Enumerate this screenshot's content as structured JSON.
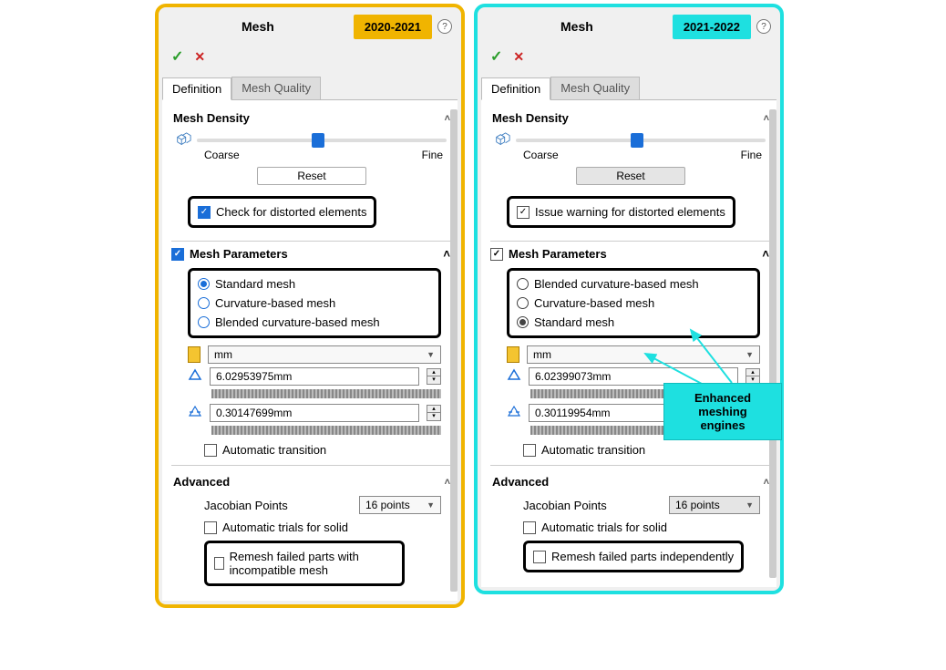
{
  "left": {
    "badge": "2020-2021",
    "title": "Mesh",
    "tabs": {
      "definition": "Definition",
      "quality": "Mesh Quality"
    },
    "density": {
      "heading": "Mesh Density",
      "coarse": "Coarse",
      "fine": "Fine",
      "reset": "Reset",
      "distort_check": "Check for distorted elements"
    },
    "params": {
      "heading": "Mesh Parameters",
      "r1": "Standard mesh",
      "r2": "Curvature-based mesh",
      "r3": "Blended curvature-based mesh",
      "unit": "mm",
      "global": "6.02953975mm",
      "tol": "0.30147699mm",
      "auto_trans": "Automatic transition"
    },
    "adv": {
      "heading": "Advanced",
      "jac_label": "Jacobian Points",
      "jac_val": "16 points",
      "auto_trials": "Automatic trials for solid",
      "remesh": "Remesh failed parts with incompatible mesh"
    }
  },
  "right": {
    "badge": "2021-2022",
    "title": "Mesh",
    "tabs": {
      "definition": "Definition",
      "quality": "Mesh Quality"
    },
    "density": {
      "heading": "Mesh Density",
      "coarse": "Coarse",
      "fine": "Fine",
      "reset": "Reset",
      "distort_check": "Issue warning for distorted elements"
    },
    "params": {
      "heading": "Mesh Parameters",
      "r1": "Blended curvature-based mesh",
      "r2": "Curvature-based mesh",
      "r3": "Standard mesh",
      "unit": "mm",
      "global": "6.02399073mm",
      "tol": "0.30119954mm",
      "auto_trans": "Automatic transition"
    },
    "adv": {
      "heading": "Advanced",
      "jac_label": "Jacobian Points",
      "jac_val": "16 points",
      "auto_trials": "Automatic trials for solid",
      "remesh": "Remesh failed parts independently"
    }
  },
  "callout": "Enhanced meshing engines"
}
